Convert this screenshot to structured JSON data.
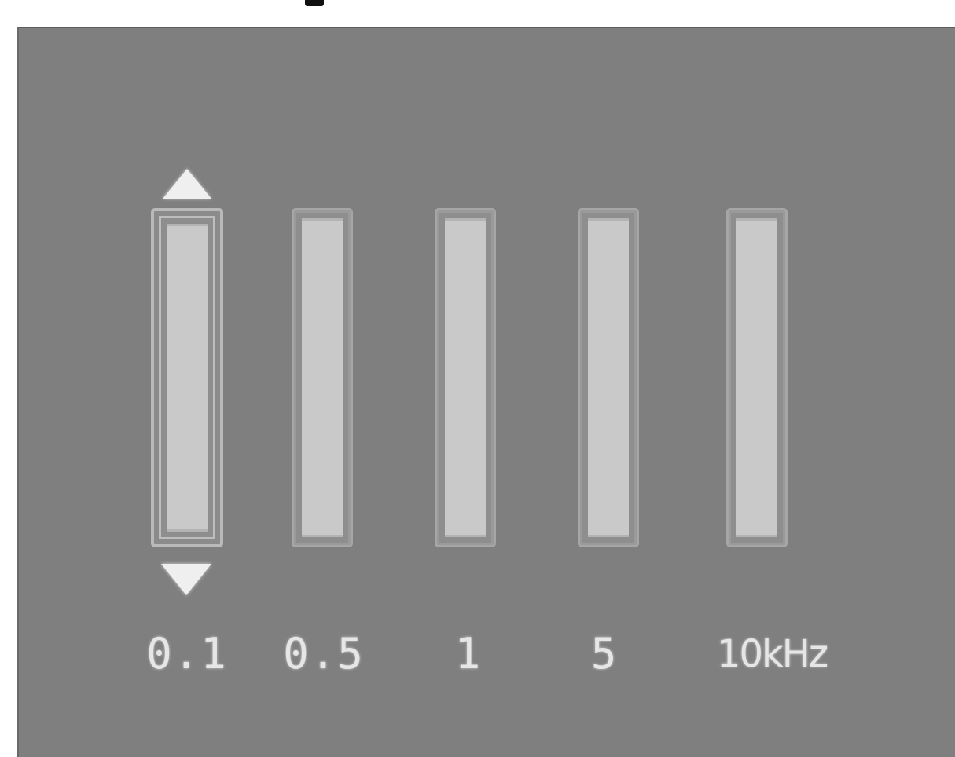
{
  "equalizer": {
    "bands": [
      {
        "label": "0.1",
        "selected": true
      },
      {
        "label": "0.5",
        "selected": false
      },
      {
        "label": "1",
        "selected": false
      },
      {
        "label": "5",
        "selected": false
      },
      {
        "label": "10kHz",
        "selected": false
      }
    ],
    "up_icon": "triangle-up-icon",
    "down_icon": "triangle-down-icon"
  },
  "colors": {
    "panel_background": "#7f7f7f",
    "slider_track": "#c9c9c9",
    "arrow": "#efefef",
    "label_text": "#e6e6e6"
  }
}
